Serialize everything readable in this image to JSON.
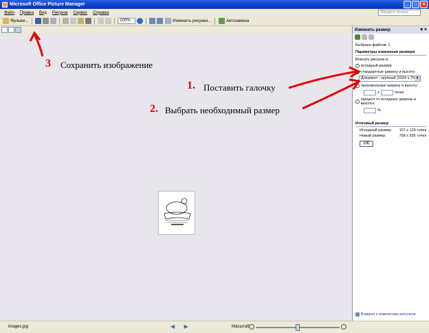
{
  "window": {
    "title": "Microsoft Office Picture Manager"
  },
  "menu": {
    "items": [
      "Файл",
      "Правка",
      "Вид",
      "Рисунок",
      "Сервис",
      "Справка"
    ],
    "ask_placeholder": "Введите вопрос"
  },
  "toolbar": {
    "shortcuts_label": "Ярлыки...",
    "zoom_value": "100%",
    "edit_pictures_label": "Изменить рисунки...",
    "autocorrect_label": "Автозамена"
  },
  "pane": {
    "title": "Изменить размер",
    "selected_files": "Выбрано файлов: 1",
    "section_resize": "Параметры изменения размера",
    "fit_label": "Вписать рисунок в:",
    "opt_original": "исходный размер",
    "opt_standard": "стандартные ширину и высоту:",
    "standard_value": "Документ - крупный (1024 x 768)",
    "opt_custom": "произвольные ширину и высоту:",
    "custom_x": "x",
    "custom_unit": "точек",
    "opt_percent": "процент от исходных ширины и высоты:",
    "percent_unit": "%",
    "section_result": "Итоговый размер",
    "orig_label": "Исходный размер:",
    "orig_value": "107 x 129 точек",
    "new_label": "Новый размер:",
    "new_value": "768 x 926 точек",
    "ok_label": "ОК",
    "footer_link": "Возврат к изменению рисунков"
  },
  "status": {
    "file_name": "images.jpg",
    "zoom_label": "Масштаб:",
    "zoom_fraction": 0.5
  },
  "annotations": {
    "step1_number": "1.",
    "step1_text": "Поставить галочку",
    "step2_number": "2.",
    "step2_text": "Выбрать необходимый размер",
    "step3_number": "3",
    "step3_text": "Сохранить изображение"
  },
  "colors": {
    "annotation": "#e20000",
    "titlebar": "#0a3fc9"
  }
}
